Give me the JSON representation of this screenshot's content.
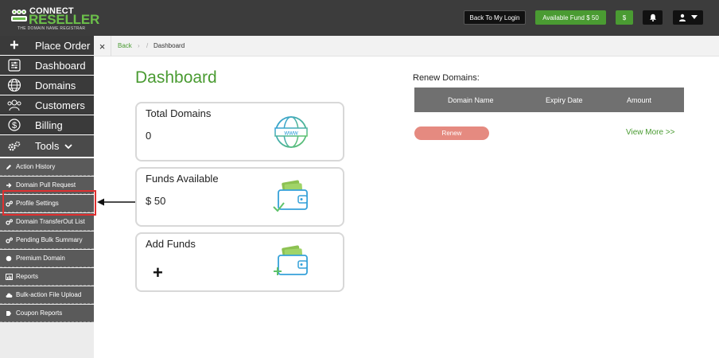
{
  "brand": {
    "line1": "CONNECT",
    "line2": "RESELLER",
    "tagline": "THE DOMAIN NAME REGISTRAR"
  },
  "topbar": {
    "back_login": "Back To My Login",
    "available_fund": "Available Fund  $ 50",
    "dollar_icon_text": "$",
    "bell_icon": "bell-icon",
    "user_icon": "user-icon"
  },
  "sidebar": {
    "place_order": "Place Order",
    "items": [
      {
        "label": "Dashboard",
        "icon": "dashboard-icon"
      },
      {
        "label": "Domains",
        "icon": "globe-icon"
      },
      {
        "label": "Customers",
        "icon": "customers-icon"
      },
      {
        "label": "Billing",
        "icon": "dollar-icon"
      },
      {
        "label": "Tools",
        "icon": "gears-icon"
      }
    ],
    "tools_submenu": [
      "Action History",
      "Domain Pull Request",
      "Profile Settings",
      "Domain TransferOut List",
      "Pending Bulk Summary",
      "Premium Domain",
      "Reports",
      "Bulk-action File Upload",
      "Coupon Reports"
    ]
  },
  "breadcrumb": {
    "close": "×",
    "back": "Back",
    "sep1": "›",
    "sep2": "/",
    "current": "Dashboard"
  },
  "main": {
    "title": "Dashboard",
    "cards": [
      {
        "title": "Total Domains",
        "value": "0",
        "icon": "www-globe-icon"
      },
      {
        "title": "Funds Available",
        "value": "$ 50",
        "icon": "wallet-check-icon"
      },
      {
        "title": "Add Funds",
        "value": "+",
        "icon": "wallet-plus-icon"
      }
    ]
  },
  "renew": {
    "title": "Renew Domains:",
    "columns": [
      "Domain Name",
      "Expiry Date",
      "Amount"
    ],
    "button": "Renew",
    "view_more": "View More >>"
  },
  "colors": {
    "accent_green": "#4a9b32",
    "topbar": "#3c3c3c",
    "highlight": "#e03030"
  }
}
